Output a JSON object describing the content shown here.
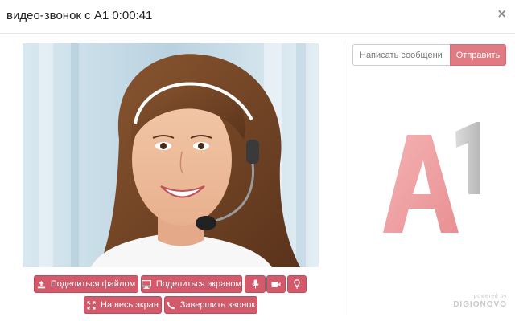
{
  "window": {
    "title": "видео-звонок с A1 0:00:41",
    "close_symbol": "×"
  },
  "video": {
    "description_icon": "video-feed"
  },
  "controls": {
    "share_file_label": "Поделиться файлом",
    "share_screen_label": "Поделиться экраном",
    "fullscreen_label": "На весь экран",
    "end_call_label": "Завершить звонок",
    "icons": [
      "upload-icon",
      "monitor-icon",
      "microphone-icon",
      "camera-icon",
      "lightbulb-icon",
      "expand-icon",
      "phone-icon"
    ]
  },
  "chat": {
    "placeholder": "Написать сообщение",
    "send_label": "Отправить"
  },
  "logo": {
    "text": "A1"
  },
  "footer": {
    "powered_by": "powered by",
    "brand": "DIGIONOVO"
  },
  "colors": {
    "accent": "#d25a6b",
    "send": "#e07a83",
    "logo_red": "#ef9a9a",
    "logo_gray": "#c8c8c8"
  }
}
